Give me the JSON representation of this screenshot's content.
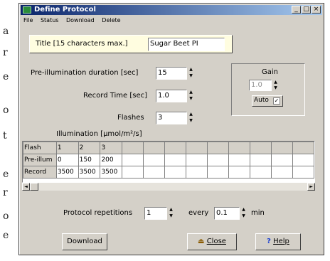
{
  "window": {
    "title": "Define Protocol",
    "minimize": "_",
    "maximize": "□",
    "close": "×"
  },
  "background_chars": [
    "a",
    "r",
    "e",
    "o",
    "t",
    "e",
    "r",
    "o",
    "e"
  ],
  "menu": [
    "File",
    "Status",
    "Download",
    "Delete"
  ],
  "title_field": {
    "label": "Title  [15 characters max.]",
    "value": "Sugar Beet PI"
  },
  "preillum": {
    "label": "Pre-illumination duration [sec]",
    "value": "15"
  },
  "record": {
    "label": "Record Time [sec]",
    "value": "1.0"
  },
  "flashes": {
    "label": "Flashes",
    "value": "3"
  },
  "gain": {
    "label": "Gain",
    "value": "1.0",
    "auto_label": "Auto",
    "auto_checked": "✓"
  },
  "illumination_label": "Illumination [µmol/m²/s]",
  "table": {
    "header": [
      "Flash",
      "1",
      "2",
      "3",
      "",
      "",
      "",
      "",
      "",
      "",
      "",
      "",
      ""
    ],
    "rows": [
      [
        "Pre-illum",
        "0",
        "150",
        "200",
        "",
        "",
        "",
        "",
        "",
        "",
        "",
        "",
        ""
      ],
      [
        "Record",
        "3500",
        "3500",
        "3500",
        "",
        "",
        "",
        "",
        "",
        "",
        "",
        "",
        ""
      ]
    ]
  },
  "scroll": {
    "left_arrow": "◄",
    "right_arrow": "►"
  },
  "repetitions": {
    "label": "Protocol repetitions",
    "value": "1",
    "every_label": "every",
    "every_value": "0.1",
    "unit": "min"
  },
  "buttons": {
    "download": "Download",
    "close": "Close",
    "help": "Help"
  }
}
